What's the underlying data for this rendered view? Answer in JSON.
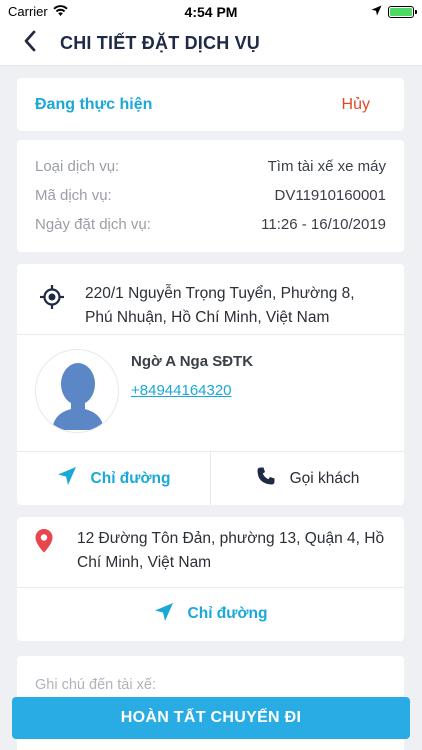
{
  "status_bar": {
    "carrier": "Carrier",
    "time": "4:54 PM"
  },
  "header": {
    "title": "CHI TIẾT ĐẶT DỊCH VỤ"
  },
  "booking_status": {
    "status": "Đang thực hiện",
    "cancel_label": "Hủy"
  },
  "service_info": {
    "rows": [
      {
        "label": "Loại dịch vụ:",
        "value": "Tìm tài xế xe máy"
      },
      {
        "label": "Mã dịch vụ:",
        "value": "DV11910160001"
      },
      {
        "label": "Ngày đặt dịch vụ:",
        "value": "11:26 - 16/10/2019"
      }
    ]
  },
  "pickup": {
    "address": "220/1 Nguyễn Trọng Tuyển, Phường 8, Phú Nhuận, Hồ Chí Minh, Việt Nam",
    "customer_name": "Ngờ A Nga SĐTK",
    "customer_phone": "+84944164320",
    "directions_label": "Chỉ đường",
    "call_label": "Gọi khách"
  },
  "destination": {
    "address": "12 Đường Tôn Đản, phường 13, Quận 4, Hồ Chí Minh, Việt Nam",
    "directions_label": "Chỉ đường"
  },
  "note": {
    "placeholder": "Ghi chú đến tài xế:"
  },
  "complete_button": {
    "label": "HOÀN TẤT CHUYẾN ĐI"
  },
  "colors": {
    "accent": "#1aa8d9",
    "cancel": "#e04a2a",
    "button": "#29ace3",
    "pin": "#e8454c"
  },
  "battery_level": 1.0
}
